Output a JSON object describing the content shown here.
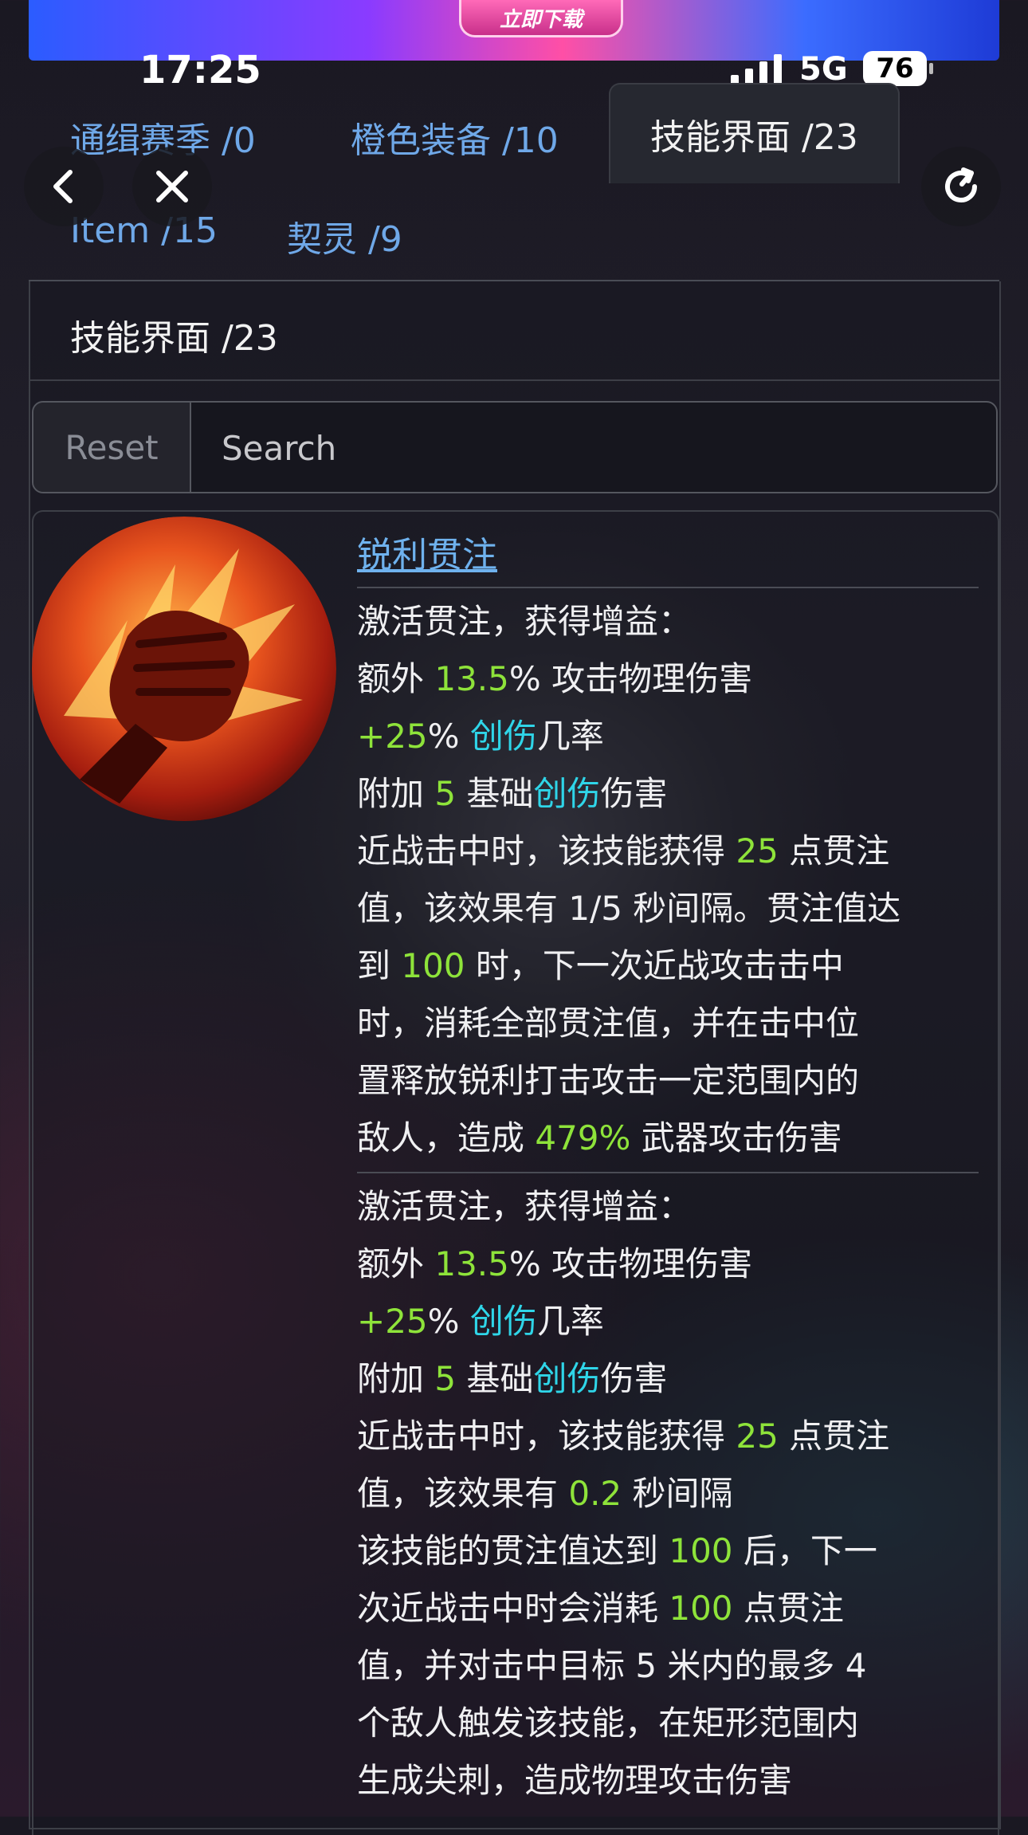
{
  "banner": {
    "button_label": "立即下载"
  },
  "status_bar": {
    "time": "17:25",
    "network": "5G",
    "battery": "76"
  },
  "tabs": [
    {
      "label": "通缉赛季 /0",
      "active": false
    },
    {
      "label": "橙色装备 /10",
      "active": false
    },
    {
      "label": "技能界面 /23",
      "active": true
    },
    {
      "label": "Item /15",
      "active": false
    },
    {
      "label": "契灵 /9",
      "active": false
    }
  ],
  "nav": {
    "back_icon": "chevron-left-icon",
    "close_icon": "close-icon",
    "refresh_icon": "refresh-icon"
  },
  "panel": {
    "title": "技能界面 /23"
  },
  "search": {
    "reset_label": "Reset",
    "placeholder": "Search"
  },
  "skill": {
    "name": "锐利贯注",
    "icon": "flaming-fist-icon",
    "desc1": {
      "l1": "激活贯注，获得增益：",
      "l2a": "额外 ",
      "l2b": "13.5",
      "l2c": "% 攻击物理伤害",
      "l3a": "+25",
      "l3b": "% ",
      "l3c": "创伤",
      "l3d": "几率",
      "l4a": "附加 ",
      "l4b": "5",
      "l4c": " 基础",
      "l4d": "创伤",
      "l4e": "伤害",
      "l5a": "近战击中时，该技能获得 ",
      "l5b": "25",
      "l5c": " 点贯注",
      "l6": "值，该效果有 1/5 秒间隔。贯注值达",
      "l7a": "到 ",
      "l7b": "100",
      "l7c": " 时，下一次近战攻击击中",
      "l8": "时，消耗全部贯注值，并在击中位",
      "l9": "置释放锐利打击攻击一定范围内的",
      "l10a": "敌人，造成 ",
      "l10b": "479%",
      "l10c": " 武器攻击伤害"
    },
    "desc2": {
      "l1": "激活贯注，获得增益：",
      "l2a": "额外 ",
      "l2b": "13.5",
      "l2c": "% 攻击物理伤害",
      "l3a": "+25",
      "l3b": "% ",
      "l3c": "创伤",
      "l3d": "几率",
      "l4a": "附加 ",
      "l4b": "5",
      "l4c": " 基础",
      "l4d": "创伤",
      "l4e": "伤害",
      "l5a": "近战击中时，该技能获得 ",
      "l5b": "25",
      "l5c": " 点贯注",
      "l6a": "值，该效果有 ",
      "l6b": "0.2",
      "l6c": " 秒间隔",
      "l7a": "该技能的贯注值达到 ",
      "l7b": "100",
      "l7c": " 后，下一",
      "l8a": "次近战击中时会消耗 ",
      "l8b": "100",
      "l8c": " 点贯注",
      "l9": "值，并对击中目标 5 米内的最多 4",
      "l10": "个敌人触发该技能，在矩形范围内",
      "l11": "生成尖刺，造成物理攻击伤害"
    }
  }
}
